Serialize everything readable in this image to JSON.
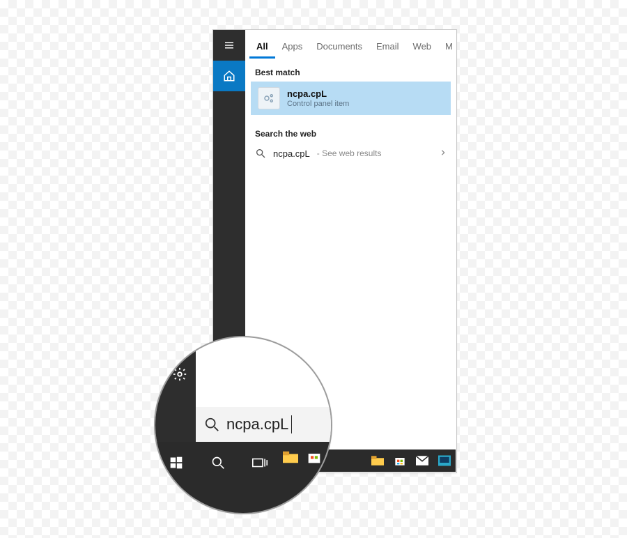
{
  "tabs": {
    "all": "All",
    "apps": "Apps",
    "documents": "Documents",
    "email": "Email",
    "web": "Web",
    "more": "M"
  },
  "sections": {
    "bestMatch": "Best match",
    "searchWeb": "Search the web"
  },
  "bestMatch": {
    "title": "ncpa.cpL",
    "subtitle": "Control panel item"
  },
  "webResult": {
    "query": "ncpa.cpL",
    "hint": " - See web results"
  },
  "searchBox": {
    "value": "ncpa.cpL"
  }
}
